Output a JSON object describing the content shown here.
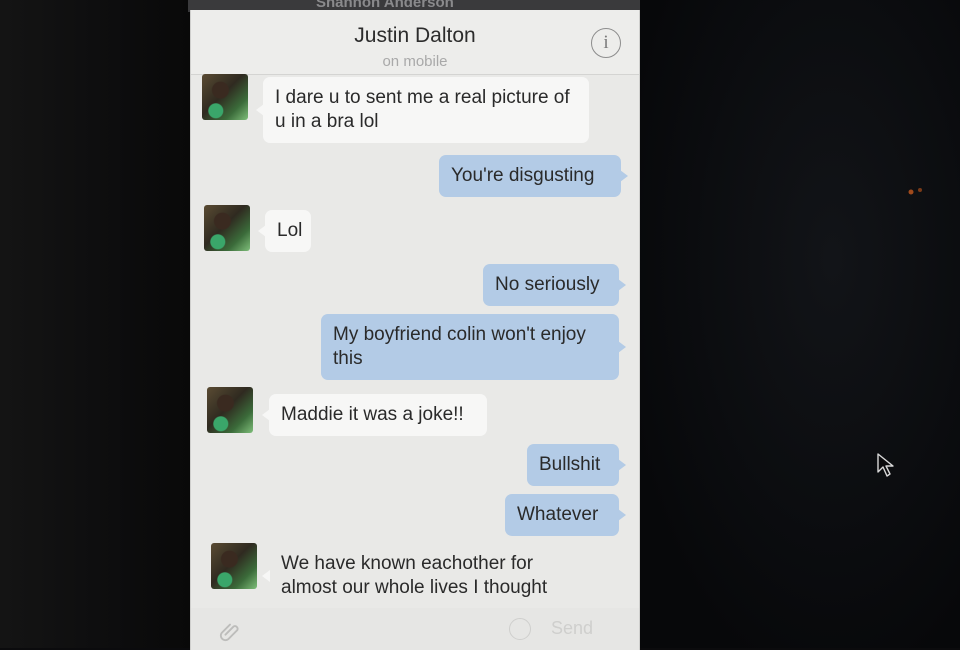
{
  "window": {
    "top_contact": "Shannon Anderson"
  },
  "header": {
    "contact_name": "Justin Dalton",
    "status": "on mobile",
    "info_icon": "info-icon",
    "info_glyph": "i"
  },
  "messages": [
    {
      "direction": "incoming",
      "text": "I dare u to sent me a real picture of u in a bra lol"
    },
    {
      "direction": "outgoing",
      "text": "You're disgusting"
    },
    {
      "direction": "incoming",
      "text": "Lol"
    },
    {
      "direction": "outgoing",
      "text": "No seriously"
    },
    {
      "direction": "outgoing",
      "text": "My boyfriend colin won't enjoy this"
    },
    {
      "direction": "incoming",
      "text": "Maddie it was a joke!!"
    },
    {
      "direction": "outgoing",
      "text": "Bullshit"
    },
    {
      "direction": "outgoing",
      "text": "Whatever"
    },
    {
      "direction": "incoming",
      "text": "We have known eachother for almost our whole lives I thought"
    }
  ],
  "composer": {
    "attach_icon": "paperclip-icon",
    "emoji_icon": "smiley-icon",
    "send_label": "Send"
  },
  "colors": {
    "outgoing_bubble": "#b3cbe6",
    "incoming_bubble": "#f7f7f6",
    "window_bg": "#e9e9e7"
  }
}
